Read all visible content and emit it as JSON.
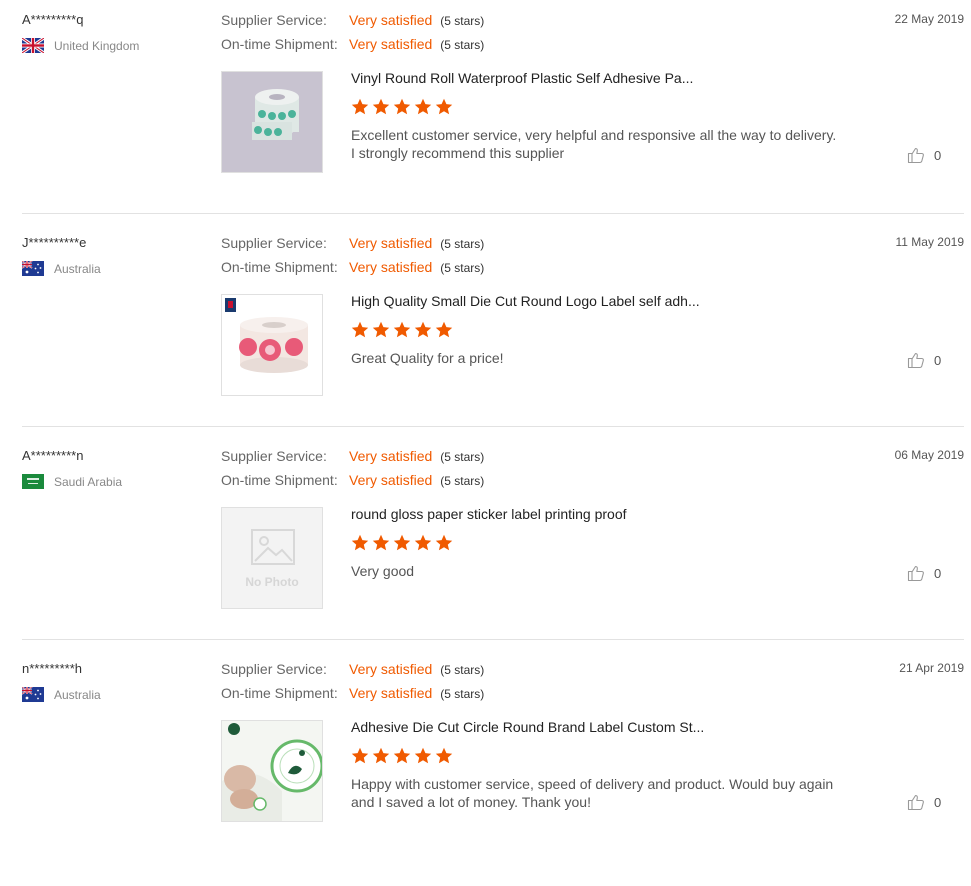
{
  "reviews": [
    {
      "buyer": "A*********q",
      "country": "United Kingdom",
      "flag": "uk",
      "date": "22 May 2019",
      "service_label": "Supplier Service:",
      "service_value": "Very satisfied",
      "service_stars": "(5 stars)",
      "shipment_label": "On-time Shipment:",
      "shipment_value": "Very satisfied",
      "shipment_stars": "(5 stars)",
      "product_title": "Vinyl Round Roll Waterproof Plastic Self Adhesive Pa...",
      "rating": 5,
      "comment_lines": [
        "Excellent customer service, very helpful and responsive all the way to delivery.",
        "I strongly  recommend this supplier"
      ],
      "likes": "0"
    },
    {
      "buyer": "J**********e",
      "country": "Australia",
      "flag": "au",
      "date": "11 May 2019",
      "service_label": "Supplier Service:",
      "service_value": "Very satisfied",
      "service_stars": "(5 stars)",
      "shipment_label": "On-time Shipment:",
      "shipment_value": "Very satisfied",
      "shipment_stars": "(5 stars)",
      "product_title": "High Quality Small Die Cut Round Logo Label self adh...",
      "rating": 5,
      "comment_lines": [
        "Great Quality for a price!"
      ],
      "likes": "0"
    },
    {
      "buyer": "A*********n",
      "country": "Saudi Arabia",
      "flag": "sa",
      "date": "06 May 2019",
      "service_label": "Supplier Service:",
      "service_value": "Very satisfied",
      "service_stars": "(5 stars)",
      "shipment_label": "On-time Shipment:",
      "shipment_value": "Very satisfied",
      "shipment_stars": "(5 stars)",
      "product_title": "round gloss paper sticker label printing proof",
      "rating": 5,
      "comment_lines": [
        "Very good"
      ],
      "no_photo_text": "No Photo",
      "likes": "0"
    },
    {
      "buyer": "n*********h",
      "country": "Australia",
      "flag": "au",
      "date": "21 Apr 2019",
      "service_label": "Supplier Service:",
      "service_value": "Very satisfied",
      "service_stars": "(5 stars)",
      "shipment_label": "On-time Shipment:",
      "shipment_value": "Very satisfied",
      "shipment_stars": "(5 stars)",
      "product_title": "Adhesive Die Cut Circle Round Brand Label Custom St...",
      "rating": 5,
      "comment_lines": [
        "Happy with customer service, speed of delivery and product. Would buy again",
        "and I saved a lot of money. Thank you!"
      ],
      "likes": "0"
    }
  ],
  "colors": {
    "accent": "#f05a00",
    "divider": "#e2e2e2",
    "star": "#f05a00"
  }
}
